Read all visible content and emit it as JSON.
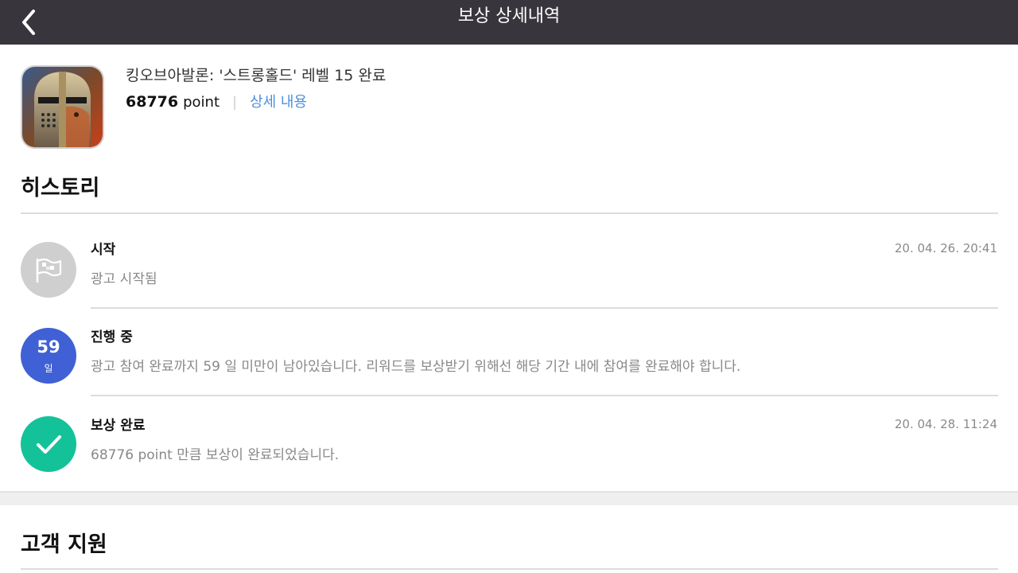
{
  "header": {
    "title": "보상 상세내역",
    "back_icon": "chevron-left-icon"
  },
  "offer": {
    "title": "킹오브아발론: '스트롱홀드' 레벨 15 완료",
    "points": "68776",
    "points_unit": "point",
    "separator": "|",
    "detail_link": "상세 내용",
    "app_icon": "knight-helmet-app-icon"
  },
  "history": {
    "section_title": "히스토리",
    "items": [
      {
        "icon": "flag-icon",
        "icon_color": "#cfcfcf",
        "title": "시작",
        "desc": "광고 시작됨",
        "date": "20. 04. 26. 20:41"
      },
      {
        "icon": "days-remaining-badge",
        "icon_color": "#4060d6",
        "days": "59",
        "days_unit": "일",
        "title": "진행 중",
        "desc": "광고 참여 완료까지 59 일 미만이 남아있습니다. 리워드를 보상받기 위해선 해당 기간 내에 참여를 완료해야 합니다.",
        "date": ""
      },
      {
        "icon": "checkmark-icon",
        "icon_color": "#14c29a",
        "title": "보상 완료",
        "desc": "68776 point 만큼 보상이 완료되었습니다.",
        "date": "20. 04. 28. 11:24"
      }
    ]
  },
  "support": {
    "section_title": "고객 지원"
  }
}
